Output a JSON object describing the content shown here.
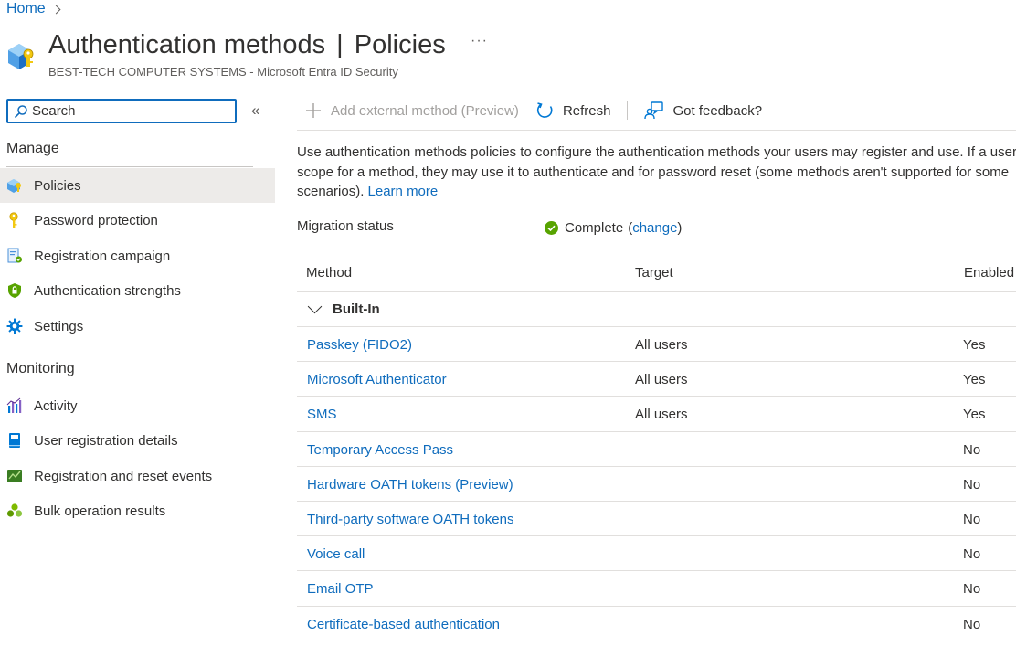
{
  "breadcrumb": {
    "home": "Home"
  },
  "header": {
    "title": "Authentication methods",
    "separator": "|",
    "subtitle_part": "Policies",
    "more": "···",
    "org": "BEST-TECH COMPUTER SYSTEMS - Microsoft Entra ID Security"
  },
  "sidebar": {
    "search_placeholder": "Search",
    "collapse": "«",
    "sections": [
      {
        "label": "Manage",
        "items": [
          {
            "label": "Policies",
            "icon": "policies-icon",
            "active": true
          },
          {
            "label": "Password protection",
            "icon": "key-icon"
          },
          {
            "label": "Registration campaign",
            "icon": "registration-campaign-icon"
          },
          {
            "label": "Authentication strengths",
            "icon": "shield-icon"
          },
          {
            "label": "Settings",
            "icon": "gear-icon"
          }
        ]
      },
      {
        "label": "Monitoring",
        "items": [
          {
            "label": "Activity",
            "icon": "activity-chart-icon"
          },
          {
            "label": "User registration details",
            "icon": "book-icon"
          },
          {
            "label": "Registration and reset events",
            "icon": "events-chart-icon"
          },
          {
            "label": "Bulk operation results",
            "icon": "bulk-operations-icon"
          }
        ]
      }
    ]
  },
  "toolbar": {
    "add_external": "Add external method (Preview)",
    "refresh": "Refresh",
    "feedback": "Got feedback?"
  },
  "description": {
    "line1": "Use authentication methods policies to configure the authentication methods your users may register and use. If a user is in",
    "line2": "scope for a method, they may use it to authenticate and for password reset (some methods aren't supported for some",
    "line3": "scenarios).",
    "learn_more": "Learn more"
  },
  "migration": {
    "label": "Migration status",
    "status": "Complete",
    "open_paren": "(",
    "change": "change",
    "close_paren": ")",
    "status_color": "#57a300"
  },
  "table": {
    "columns": {
      "method": "Method",
      "target": "Target",
      "enabled": "Enabled"
    },
    "group": "Built-In",
    "rows": [
      {
        "method": "Passkey (FIDO2)",
        "target": "All users",
        "enabled": "Yes"
      },
      {
        "method": "Microsoft Authenticator",
        "target": "All users",
        "enabled": "Yes"
      },
      {
        "method": "SMS",
        "target": "All users",
        "enabled": "Yes"
      },
      {
        "method": "Temporary Access Pass",
        "target": "",
        "enabled": "No"
      },
      {
        "method": "Hardware OATH tokens (Preview)",
        "target": "",
        "enabled": "No"
      },
      {
        "method": "Third-party software OATH tokens",
        "target": "",
        "enabled": "No"
      },
      {
        "method": "Voice call",
        "target": "",
        "enabled": "No"
      },
      {
        "method": "Email OTP",
        "target": "",
        "enabled": "No"
      },
      {
        "method": "Certificate-based authentication",
        "target": "",
        "enabled": "No"
      }
    ]
  },
  "colors": {
    "link": "#0f6cbd",
    "accent": "#0078d4",
    "active_nav_bg": "#edebe9"
  }
}
